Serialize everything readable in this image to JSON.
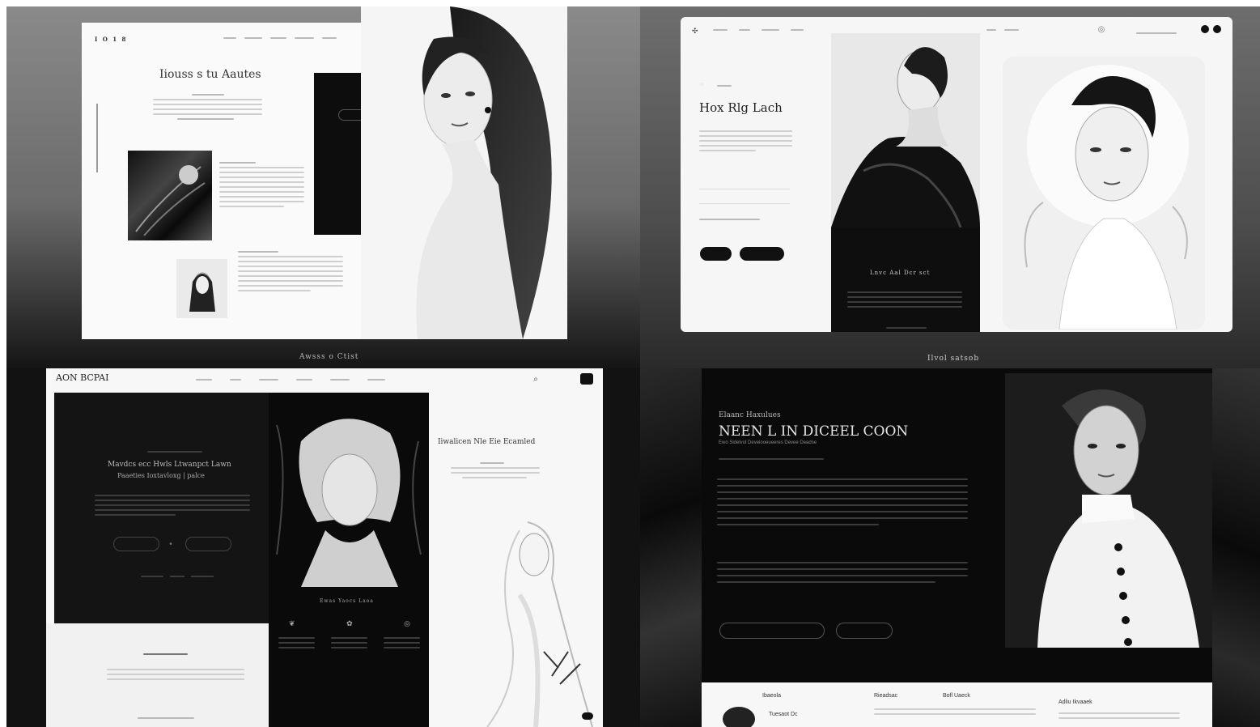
{
  "panel_tl": {
    "nav_logo": "I O 1 8",
    "headline": "Iiouss s tu Aautes",
    "caption": "Awsss o Ctist"
  },
  "panel_tr": {
    "headline": "Hox Rlg Lach",
    "dark_panel_heading": "Lnvc Aal Dcr sct",
    "caption": "Ilvol satsob"
  },
  "panel_bl": {
    "logo": "AON BCPAI",
    "dark_headline": "Mavdcs ecc Hwls Ltwanpct Lawn",
    "dark_subline": "Paaeties Ioxtavloxg | palce",
    "right_headline": "Iiwalicen Nle Eie Ecamled",
    "card_heading": "Ewas Yaocs Laoa"
  },
  "panel_br": {
    "eyebrow": "Elaanc Haxulues",
    "headline": "NEEN L IN DICEEL COON",
    "subline": "Ewo Sidelvul Deveiooeueeres Devee Deadse",
    "footer_col1": "Ibaeola",
    "footer_col2": "Rieadsac",
    "footer_col3": "Bofl Uaeck",
    "footer_col4": "Adliu Ikvaaek",
    "profile_name": "Tuesaot Dc"
  },
  "colors": {
    "black": "#0c0c0c",
    "white": "#ffffff",
    "mid_gray": "#6e6e6e"
  }
}
